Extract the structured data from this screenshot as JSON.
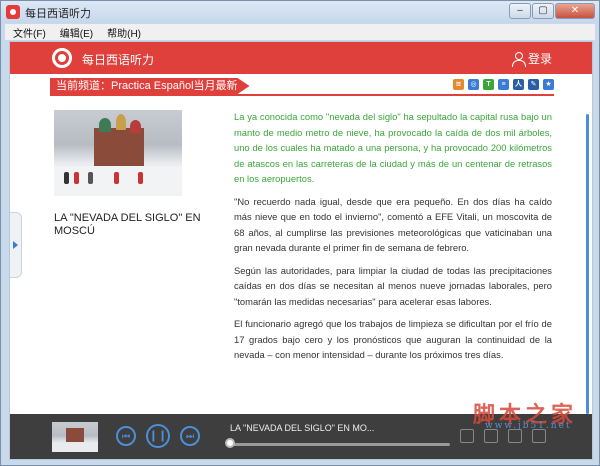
{
  "window": {
    "title": "每日西语听力",
    "controls": {
      "minimize": "–",
      "maximize": "▢",
      "close": "✕"
    }
  },
  "menu": [
    "文件(F)",
    "编辑(E)",
    "帮助(H)"
  ],
  "header": {
    "brand": "每日西语听力",
    "login_label": "登录",
    "accent_color": "#e0403b"
  },
  "channel": {
    "label": "当前频道：Practica Español当月最新",
    "tools": [
      {
        "icon": "rss-icon",
        "color": "#e8892f"
      },
      {
        "icon": "share-icon",
        "color": "#3a7bd5"
      },
      {
        "icon": "text-icon",
        "color": "#3aa63a"
      },
      {
        "icon": "doc-icon",
        "color": "#3a7bd5"
      },
      {
        "icon": "person-icon",
        "color": "#2a5ea8"
      },
      {
        "icon": "edit-icon",
        "color": "#2a5ea8"
      },
      {
        "icon": "star-icon",
        "color": "#3a7bd5"
      }
    ]
  },
  "article": {
    "title": "LA \"NEVADA DEL SIGLO\" EN MOSCÚ",
    "paragraphs": [
      "La ya conocida como \"nevada del siglo\" ha sepultado la capital rusa bajo un manto de medio metro de nieve, ha provocado la caída de dos mil árboles, uno de los cuales ha matado a una persona, y ha provocado 200 kilómetros de atascos en las carreteras de la ciudad y más de un centenar de retrasos en los aeropuertos.",
      "\"No recuerdo nada igual, desde que era pequeño. En dos días ha caído más nieve que en todo el invierno\", comentó a EFE Vitali, un moscovita de 68 años, al cumplirse las previsiones meteorológicas que vaticinaban una gran nevada durante el primer fin de semana de febrero.",
      "Según las autoridades, para limpiar la ciudad de todas las precipitaciones caídas en dos días se necesitan al menos nueve jornadas laborales, pero \"tomarán las medidas necesarias\" para acelerar esas labores.",
      "El funcionario agregó que los trabajos de limpieza se dificultan por el frío de 17 grados bajo cero y los pronósticos que auguran la continuidad de la nevada – con menor intensidad – durante los próximos tres días."
    ]
  },
  "player": {
    "now_playing": "LA \"NEVADA DEL SIGLO\" EN MO...",
    "progress": 0.0,
    "buttons": {
      "prev": "⏮",
      "play": "❙❙",
      "next": "⏭"
    }
  },
  "watermark": {
    "title": "脚本之家",
    "url": "www.jb51.net"
  }
}
